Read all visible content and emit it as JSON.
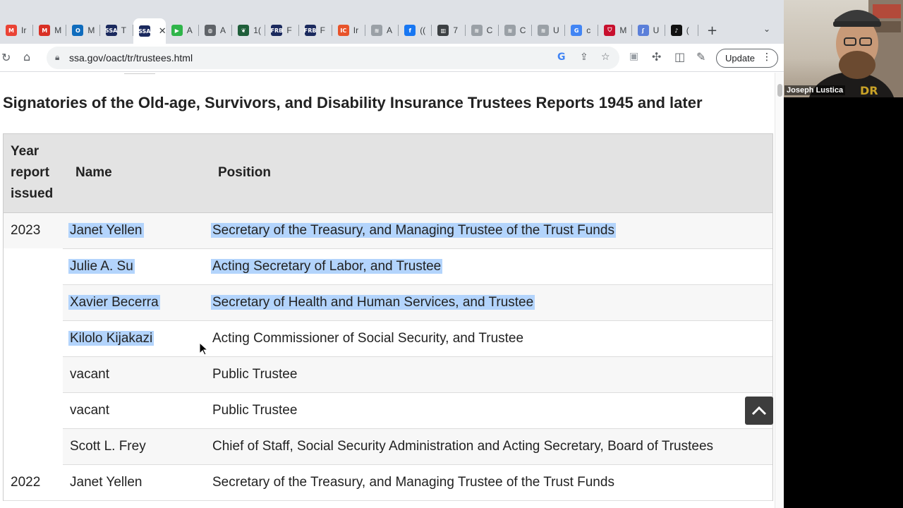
{
  "tabs": [
    {
      "icon": "gmail-icon",
      "label": "Ir",
      "color": "#ea4335",
      "glyph": "M"
    },
    {
      "icon": "gmail-red-icon",
      "label": "M",
      "color": "#d93025",
      "glyph": "M"
    },
    {
      "icon": "outlook-icon",
      "label": "M",
      "color": "#0f6cbd",
      "glyph": "O"
    },
    {
      "icon": "ssa-icon",
      "label": "T",
      "color": "#1b2a5e",
      "glyph": "SSA"
    },
    {
      "icon": "ssa-icon",
      "label": "",
      "color": "#1b2a5e",
      "glyph": "SSA",
      "active": true
    },
    {
      "icon": "play-icon",
      "label": "A",
      "color": "#2fb54a",
      "glyph": "▶"
    },
    {
      "icon": "globe-icon",
      "label": "A",
      "color": "#5f6368",
      "glyph": "◍"
    },
    {
      "icon": "leaf-icon",
      "label": "1(",
      "color": "#1f5e3a",
      "glyph": "❦"
    },
    {
      "icon": "frb-icon",
      "label": "F",
      "color": "#1b2a5e",
      "glyph": "FRB"
    },
    {
      "icon": "frb-icon",
      "label": "F",
      "color": "#1b2a5e",
      "glyph": "FRB"
    },
    {
      "icon": "ic-icon",
      "label": "Ir",
      "color": "#e8542b",
      "glyph": "IC"
    },
    {
      "icon": "wave-icon",
      "label": "A",
      "color": "#9aa0a6",
      "glyph": "≋"
    },
    {
      "icon": "facebook-icon",
      "label": "((",
      "color": "#1877f2",
      "glyph": "f"
    },
    {
      "icon": "building-icon",
      "label": "7",
      "color": "#3c4043",
      "glyph": "▥"
    },
    {
      "icon": "wave-icon",
      "label": "C",
      "color": "#9aa0a6",
      "glyph": "≋"
    },
    {
      "icon": "wave-icon",
      "label": "C",
      "color": "#9aa0a6",
      "glyph": "≋"
    },
    {
      "icon": "wave-icon",
      "label": "U",
      "color": "#9aa0a6",
      "glyph": "≋"
    },
    {
      "icon": "google-icon",
      "label": "c",
      "color": "#4285f4",
      "glyph": "G"
    },
    {
      "icon": "shield-icon",
      "label": "M",
      "color": "#c8102e",
      "glyph": "⛉"
    },
    {
      "icon": "scholar-icon",
      "label": "U",
      "color": "#5b7fd9",
      "glyph": "ʃ"
    },
    {
      "icon": "tiktok-icon",
      "label": "(",
      "color": "#111111",
      "glyph": "♪"
    }
  ],
  "toolbar": {
    "url": "ssa.gov/oact/tr/trustees.html",
    "update_label": "Update"
  },
  "page": {
    "title": "Signatories of the Old-age, Survivors, and Disability Insurance Trustees Reports 1945 and later",
    "headers": {
      "year_line1": "Year",
      "year_line2": "report",
      "year_line3": "issued",
      "name": "Name",
      "position": "Position"
    },
    "rows": [
      {
        "year": "2023",
        "name": "Janet Yellen",
        "position": "Secretary of the Treasury, and Managing Trustee of the Trust Funds",
        "name_hl": true,
        "pos_hl": true
      },
      {
        "year": "",
        "name": "Julie A. Su",
        "position": "Acting Secretary of Labor, and Trustee",
        "name_hl": true,
        "pos_hl": true
      },
      {
        "year": "",
        "name": "Xavier Becerra",
        "position": "Secretary of Health and Human Services, and Trustee",
        "name_hl": true,
        "pos_hl": true
      },
      {
        "year": "",
        "name": "Kilolo Kijakazi",
        "position": "Acting Commissioner of Social Security, and Trustee",
        "name_hl": true,
        "pos_hl": false
      },
      {
        "year": "",
        "name": "vacant",
        "position": "Public Trustee",
        "name_hl": false,
        "pos_hl": false
      },
      {
        "year": "",
        "name": "vacant",
        "position": "Public Trustee",
        "name_hl": false,
        "pos_hl": false
      },
      {
        "year": "",
        "name": "Scott L. Frey",
        "position": "Chief of Staff, Social Security Administration and Acting Secretary, Board of Trustees",
        "name_hl": false,
        "pos_hl": false
      },
      {
        "year": "2022",
        "name": "Janet Yellen",
        "position": "Secretary of the Treasury, and Managing Trustee of the Trust Funds",
        "name_hl": false,
        "pos_hl": false
      }
    ]
  },
  "webcam": {
    "name": "Joseph Lustica"
  },
  "colors": {
    "selection": "#b3d4fc",
    "header_bg": "#e3e3e3"
  }
}
